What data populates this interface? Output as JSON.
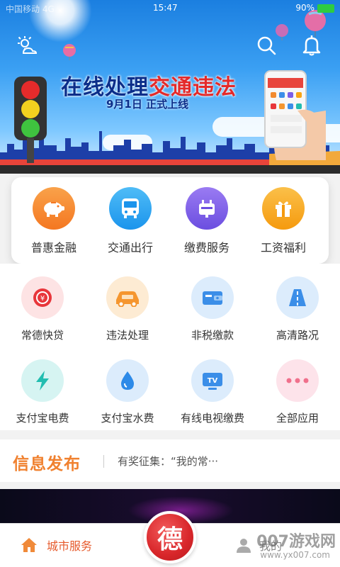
{
  "status_bar": {
    "time": "15:47",
    "battery": "90%",
    "carrier": "中国移动 4G"
  },
  "banner": {
    "title_part1": "在线处理",
    "title_part2": "交通",
    "title_part3": "违法",
    "subtitle": "9月1日  正式上线",
    "dots_count": 5,
    "active_dot": 1
  },
  "quick_services": [
    {
      "label": "普惠金融",
      "icon": "piggy-bank-icon",
      "color": "#f6862c"
    },
    {
      "label": "交通出行",
      "icon": "bus-icon",
      "color": "#2aa4f4"
    },
    {
      "label": "缴费服务",
      "icon": "payment-icon",
      "color": "#7b5ee8"
    },
    {
      "label": "工资福利",
      "icon": "gift-icon",
      "color": "#f9a516"
    }
  ],
  "apps": [
    {
      "label": "常德快贷",
      "icon": "loan-icon",
      "bg": "#fde3e4",
      "fg": "#e8363b"
    },
    {
      "label": "违法处理",
      "icon": "car-icon",
      "bg": "#fdebd3",
      "fg": "#f5962f"
    },
    {
      "label": "非税缴款",
      "icon": "wallet-icon",
      "bg": "#dcecfc",
      "fg": "#3b8ee8"
    },
    {
      "label": "高清路况",
      "icon": "road-icon",
      "bg": "#dcecfc",
      "fg": "#3b8ee8"
    },
    {
      "label": "支付宝电费",
      "icon": "lightning-icon",
      "bg": "#d6f4f2",
      "fg": "#22bdb0"
    },
    {
      "label": "支付宝水费",
      "icon": "water-drop-icon",
      "bg": "#dcecfc",
      "fg": "#2d8ae8"
    },
    {
      "label": "有线电视缴费",
      "icon": "tv-icon",
      "bg": "#dcecfc",
      "fg": "#3b8ee8"
    },
    {
      "label": "全部应用",
      "icon": "more-dots-icon",
      "bg": "#fde3ea",
      "fg": "#f0708c"
    }
  ],
  "news": {
    "title": "信息发布",
    "text": "有奖征集：“我的常···"
  },
  "tabbar": {
    "left_label": "城市服务",
    "center_char": "德",
    "right_label": "我的"
  },
  "watermark": {
    "text": "007游戏网",
    "url": "www.yx007.com"
  }
}
